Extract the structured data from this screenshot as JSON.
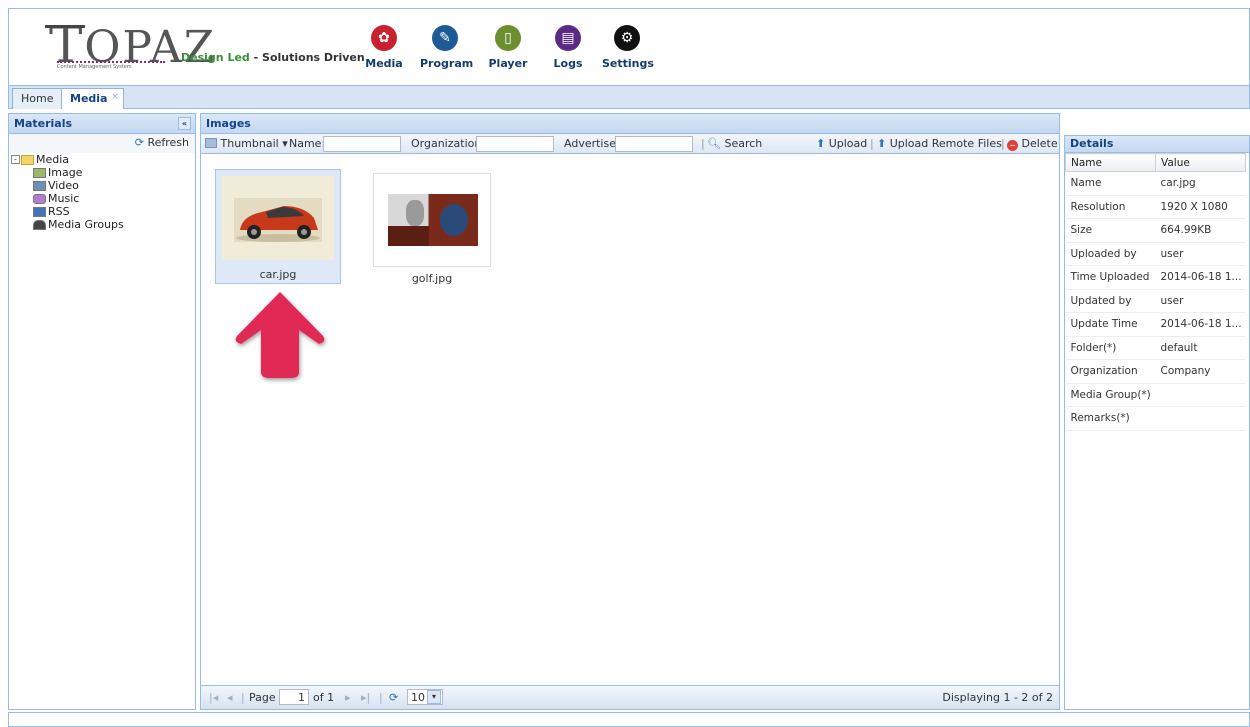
{
  "header": {
    "logo_text": "OPAZ",
    "logo_sub": "Content Management System",
    "slogan_green": "Design Led",
    "slogan_rest": " - Solutions Driven",
    "nav": [
      {
        "label": "Media",
        "icon": "media-icon",
        "color": "#c8202c"
      },
      {
        "label": "Program",
        "icon": "program-icon",
        "color": "#1e5a95"
      },
      {
        "label": "Player",
        "icon": "player-icon",
        "color": "#6b8e2f"
      },
      {
        "label": "Logs",
        "icon": "logs-icon",
        "color": "#5a2a85"
      },
      {
        "label": "Settings",
        "icon": "settings-icon",
        "color": "#111111"
      }
    ]
  },
  "tabs": [
    {
      "label": "Home"
    },
    {
      "label": "Media",
      "close": "×"
    }
  ],
  "left": {
    "title": "Materials",
    "collapse": "«",
    "refresh": "Refresh",
    "tree": {
      "root": "Media",
      "items": [
        "Image",
        "Video",
        "Music",
        "RSS",
        "Media Groups"
      ]
    }
  },
  "center": {
    "title": "Images",
    "toolbar": {
      "view": "Thumbnail",
      "name_label": "Name:",
      "org_label": "Organization:",
      "adv_label": "Advertiser:",
      "search": "Search",
      "upload": "Upload",
      "upload_remote": "Upload Remote Files",
      "delete": "Delete"
    },
    "thumbnails": [
      {
        "caption": "car.jpg",
        "selected": true
      },
      {
        "caption": "golf.jpg",
        "selected": false
      }
    ],
    "pager": {
      "page_label": "Page",
      "page_value": "1",
      "of": "of 1",
      "page_size": "10",
      "status": "Displaying 1 - 2 of 2"
    }
  },
  "details": {
    "title": "Details",
    "col_name": "Name",
    "col_value": "Value",
    "rows": [
      {
        "name": "Name",
        "value": "car.jpg"
      },
      {
        "name": "Resolution",
        "value": "1920 X 1080"
      },
      {
        "name": "Size",
        "value": "664.99KB"
      },
      {
        "name": "Uploaded by",
        "value": "user"
      },
      {
        "name": "Time Uploaded",
        "value": "2014-06-18 1..."
      },
      {
        "name": "Updated by",
        "value": "user"
      },
      {
        "name": "Update Time",
        "value": "2014-06-18 1..."
      },
      {
        "name": "Folder(*)",
        "value": "default"
      },
      {
        "name": "Organization",
        "value": "Company"
      },
      {
        "name": "Media Group(*)",
        "value": ""
      },
      {
        "name": "Remarks(*)",
        "value": ""
      }
    ]
  }
}
